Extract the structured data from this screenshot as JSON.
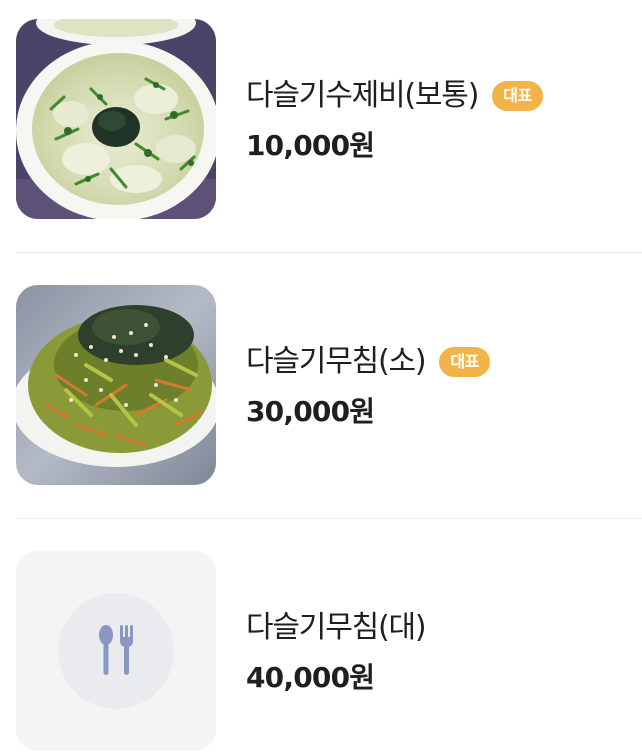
{
  "menu": {
    "items": [
      {
        "name": "다슬기수제비(보통)",
        "badge": "대표",
        "price": "10,000원",
        "image": "sujebi-soup-photo"
      },
      {
        "name": "다슬기무침(소)",
        "badge": "대표",
        "price": "30,000원",
        "image": "seasoned-salad-photo"
      },
      {
        "name": "다슬기무침(대)",
        "price": "40,000원",
        "image": "placeholder-fork-spoon-icon"
      }
    ]
  },
  "colors": {
    "badge": "#f2b349",
    "divider": "#ececec",
    "placeholder_bg": "#f4f4f5",
    "placeholder_circle": "#e9ebef",
    "placeholder_icon": "#8a97c2",
    "text": "#1f1f1f"
  }
}
